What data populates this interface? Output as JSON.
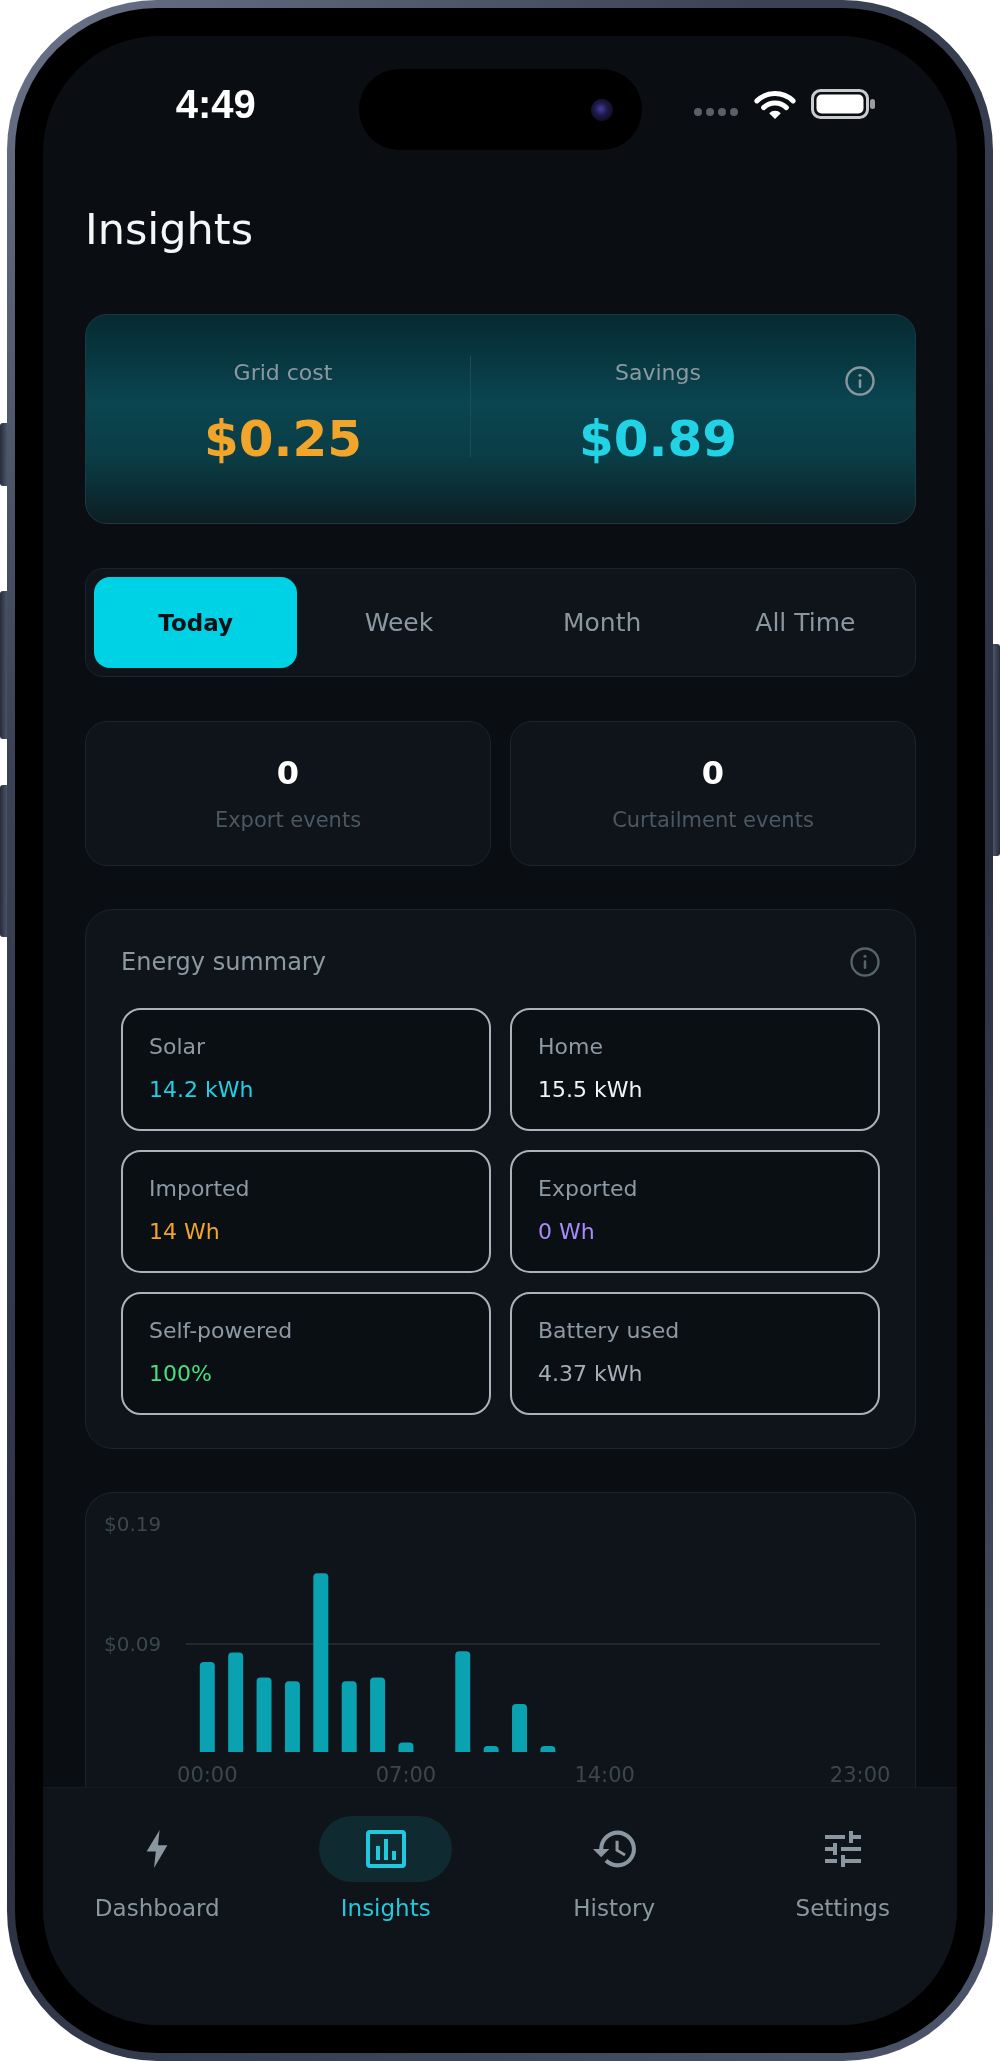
{
  "status_bar": {
    "time": "4:49"
  },
  "title": "Insights",
  "cost_summary": [
    {
      "label": "Grid cost",
      "value": "$0.25",
      "color": "#f2a52b"
    },
    {
      "label": "Savings",
      "value": "$0.89",
      "color": "#22d3e6"
    }
  ],
  "period_tabs": [
    {
      "label": "Today",
      "selected": true
    },
    {
      "label": "Week",
      "selected": false
    },
    {
      "label": "Month",
      "selected": false
    },
    {
      "label": "All Time",
      "selected": false
    }
  ],
  "event_counts": [
    {
      "value": "0",
      "label": "Export events"
    },
    {
      "value": "0",
      "label": "Curtailment events"
    }
  ],
  "energy_summary": {
    "title": "Energy summary",
    "metrics": [
      {
        "label": "Solar",
        "value": "14.2 kWh",
        "color": "#22cfe4"
      },
      {
        "label": "Home",
        "value": "15.5 kWh",
        "color": "#f1f4f6"
      },
      {
        "label": "Imported",
        "value": "14 Wh",
        "color": "#f2a52b"
      },
      {
        "label": "Exported",
        "value": "0 Wh",
        "color": "#a78bfa"
      },
      {
        "label": "Self-powered",
        "value": "100%",
        "color": "#4ade80"
      },
      {
        "label": "Battery used",
        "value": "4.37 kWh",
        "color": "#a3aeb7"
      }
    ]
  },
  "cost_chart": {
    "chart_data": {
      "type": "bar",
      "x": [
        0,
        1,
        2,
        3,
        4,
        5,
        6,
        7,
        8,
        9,
        10,
        11,
        12,
        13,
        14,
        15,
        16,
        17,
        18,
        19,
        20,
        21,
        22,
        23
      ],
      "values": [
        0.075,
        0.083,
        0.062,
        0.059,
        0.149,
        0.059,
        0.062,
        0.008,
        0,
        0.084,
        0.005,
        0.04,
        0.005,
        0,
        0,
        0,
        0,
        0,
        0,
        0,
        0,
        0,
        0,
        0
      ],
      "xlim": [
        -0.75,
        23.7
      ],
      "ylim": [
        0,
        0.19
      ],
      "xticks": [
        {
          "value": 0,
          "label": "00:00"
        },
        {
          "value": 7,
          "label": "07:00"
        },
        {
          "value": 14,
          "label": "14:00"
        },
        {
          "value": 23,
          "label": "23:00"
        }
      ],
      "yticks": [
        {
          "value": 0.09,
          "label": "$0.09"
        },
        {
          "value": 0.19,
          "label": "$0.19"
        }
      ]
    }
  },
  "tab_bar": [
    {
      "label": "Dashboard",
      "selected": false
    },
    {
      "label": "Insights",
      "selected": true
    },
    {
      "label": "History",
      "selected": false
    },
    {
      "label": "Settings",
      "selected": false
    }
  ]
}
